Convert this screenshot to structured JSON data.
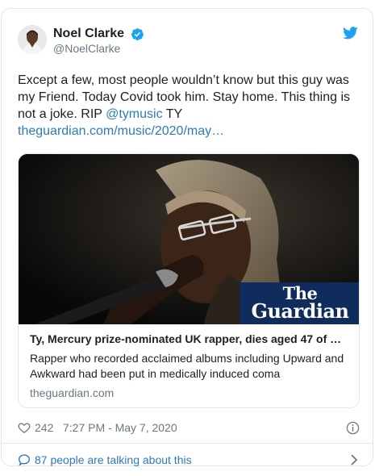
{
  "author": {
    "display_name": "Noel Clarke",
    "handle": "@NoelClarke"
  },
  "tweet": {
    "text_parts": {
      "part1": "Except a few, most people wouldn’t know but this guy was my Friend.  Today Covid took him. Stay home. This thing is not a joke. RIP ",
      "mention": "@tymusic",
      "part2": " TY ",
      "link": "theguardian.com/music/2020/may…"
    }
  },
  "card": {
    "logo_line1": "The",
    "logo_line2": "Guardian",
    "title": "Ty, Mercury prize-nominated UK rapper, dies aged 47 of …",
    "description": "Rapper who recorded acclaimed albums including Upward and Awkward had been put in medically induced coma",
    "domain": "theguardian.com"
  },
  "meta": {
    "likes": "242",
    "timestamp": "7:27 PM - May 7, 2020"
  },
  "footer": {
    "talking_label": "87 people are talking about this"
  },
  "icons": {
    "verified": "verified-badge-icon",
    "twitter": "twitter-bird-icon",
    "heart": "heart-icon",
    "info": "info-icon",
    "comment": "speech-bubble-icon",
    "chevron": "chevron-right-icon"
  },
  "colors": {
    "link": "#2b7bb9",
    "twitter_blue": "#1da1f2",
    "muted": "#697882",
    "guardian_navy": "#0f2c5c"
  }
}
